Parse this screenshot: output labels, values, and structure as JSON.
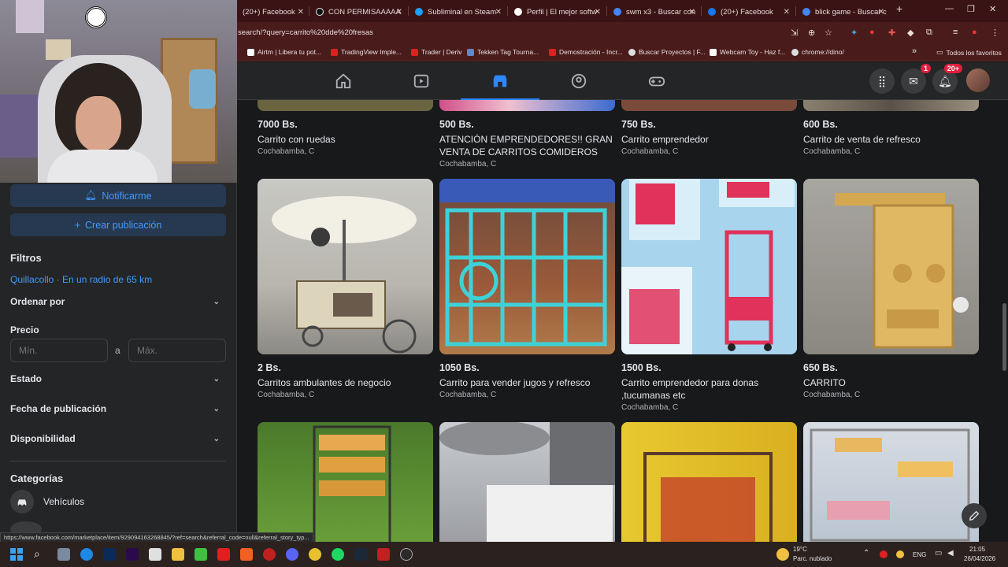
{
  "browser": {
    "tabs": [
      {
        "label": "(20+) Facebook",
        "color": "#1877f2"
      },
      {
        "label": "CON PERMISAAAAA",
        "color": "#000000"
      },
      {
        "label": "Subliminal en Steam",
        "color": "#1b2838"
      },
      {
        "label": "Perfil | El mejor softw",
        "color": "#ffffff"
      },
      {
        "label": "swm x3 - Buscar con",
        "color": "#4285f4"
      },
      {
        "label": "(20+) Facebook",
        "color": "#1877f2"
      },
      {
        "label": "blick game - Buscar c",
        "color": "#4285f4"
      }
    ],
    "url": "search/?query=carrito%20dde%20fresas",
    "bookmarks": [
      {
        "label": "Airtm | Libera tu pot...",
        "color": "#ffffff"
      },
      {
        "label": "TradingView Imple...",
        "color": "#e02020"
      },
      {
        "label": "Trader | Deriv",
        "color": "#e02020"
      },
      {
        "label": "Tekken Tag Tourna...",
        "color": "#5a8ad0"
      },
      {
        "label": "Demostración - Incr...",
        "color": "#e02020"
      },
      {
        "label": "Buscar Proyectos | F...",
        "color": "#dddddd"
      },
      {
        "label": "Webcam Toy - Haz f...",
        "color": "#ffffff"
      },
      {
        "label": "chrome://dino/",
        "color": "#dddddd"
      }
    ],
    "all_bookmarks": "Todos los favoritos"
  },
  "facebook": {
    "badges": {
      "messenger": "1",
      "notifications": "20+"
    }
  },
  "sidebar": {
    "notify_label": "Notificarme",
    "create_label": "Crear publicación",
    "filters_title": "Filtros",
    "location": "Quillacollo · En un radio de 65 km",
    "sort_label": "Ordenar por",
    "price_label": "Precio",
    "min_placeholder": "Mín.",
    "max_placeholder": "Máx.",
    "price_sep": "a",
    "condition_label": "Estado",
    "date_label": "Fecha de publicación",
    "availability_label": "Disponibilidad",
    "categories_title": "Categorías",
    "category_vehicles": "Vehículos"
  },
  "listings_top": [
    {
      "price": "7000 Bs.",
      "title": "Carrito con ruedas",
      "location": "Cochabamba, C",
      "color": "#6a6540"
    },
    {
      "price": "500 Bs.",
      "title": "ATENCIÓN EMPRENDEDORES!! GRAN VENTA DE CARRITOS COMIDEROS",
      "location": "Cochabamba, C",
      "color": "#b04c7a"
    },
    {
      "price": "750 Bs.",
      "title": "Carrito emprendedor",
      "location": "Cochabamba, C",
      "color": "#7a4a3a"
    },
    {
      "price": "600 Bs.",
      "title": "Carrito de venta de refresco",
      "location": "Cochabamba, C",
      "color": "#8a8070"
    }
  ],
  "listings_mid": [
    {
      "price": "2 Bs.",
      "title": "Carritos ambulantes de negocio",
      "location": "Cochabamba, C"
    },
    {
      "price": "1050 Bs.",
      "title": "Carrito para vender jugos y refresco",
      "location": "Cochabamba, C"
    },
    {
      "price": "1500 Bs.",
      "title": "Carrito emprendedor para donas ,tucumanas etc",
      "location": "Cochabamba, C"
    },
    {
      "price": "650 Bs.",
      "title": "CARRITO",
      "location": "Cochabamba, C"
    }
  ],
  "status_url": "https://www.facebook.com/marketplace/item/929094163268845/?ref=search&referral_code=null&referral_story_typ...",
  "taskbar": {
    "temp": "19°C",
    "weather": "Parc. nublado",
    "lang": "ENG",
    "time": "21:05",
    "date": "26/04/2026"
  }
}
